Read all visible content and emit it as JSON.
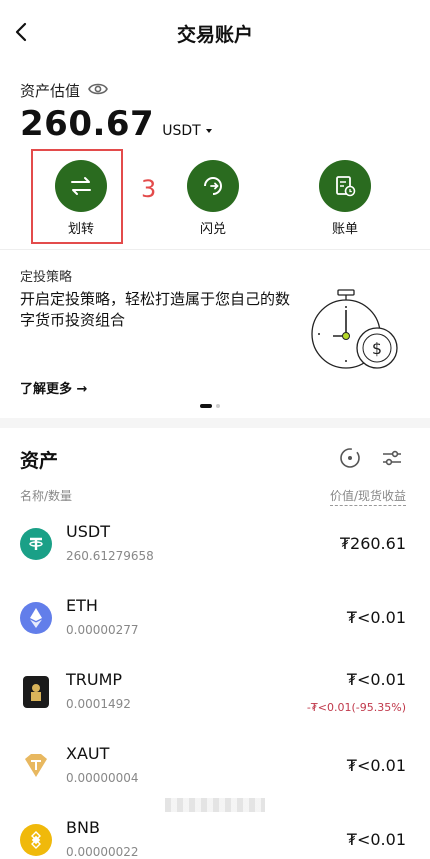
{
  "header": {
    "title": "交易账户",
    "back_icon": "chevron-left-icon"
  },
  "estimate": {
    "label": "资产估值",
    "eye_icon": "eye-icon",
    "amount": "260.67",
    "currency": "USDT"
  },
  "actions": [
    {
      "label": "划转",
      "icon": "transfer-icon"
    },
    {
      "label": "闪兑",
      "icon": "swap-icon"
    },
    {
      "label": "账单",
      "icon": "bill-icon"
    }
  ],
  "annotation": {
    "number": "3",
    "color": "#e34b4b"
  },
  "promo": {
    "title": "定投策略",
    "text": "开启定投策略，轻松打造属于您自己的数字货币投资组合",
    "link": "了解更多 →"
  },
  "assets": {
    "title": "资产",
    "col_left": "名称/数量",
    "col_right": "价值/现货收益",
    "items": [
      {
        "symbol": "USDT",
        "qty": "260.61279658",
        "value": "₮260.61",
        "pnl": ""
      },
      {
        "symbol": "ETH",
        "qty": "0.00000277",
        "value": "₮<0.01",
        "pnl": ""
      },
      {
        "symbol": "TRUMP",
        "qty": "0.0001492",
        "value": "₮<0.01",
        "pnl": "-₮<0.01(-95.35%)"
      },
      {
        "symbol": "XAUT",
        "qty": "0.00000004",
        "value": "₮<0.01",
        "pnl": ""
      },
      {
        "symbol": "BNB",
        "qty": "0.00000022",
        "value": "₮<0.01",
        "pnl": ""
      }
    ]
  },
  "colors": {
    "accent_green": "#2a6b1f",
    "loss_red": "#c0394b"
  }
}
